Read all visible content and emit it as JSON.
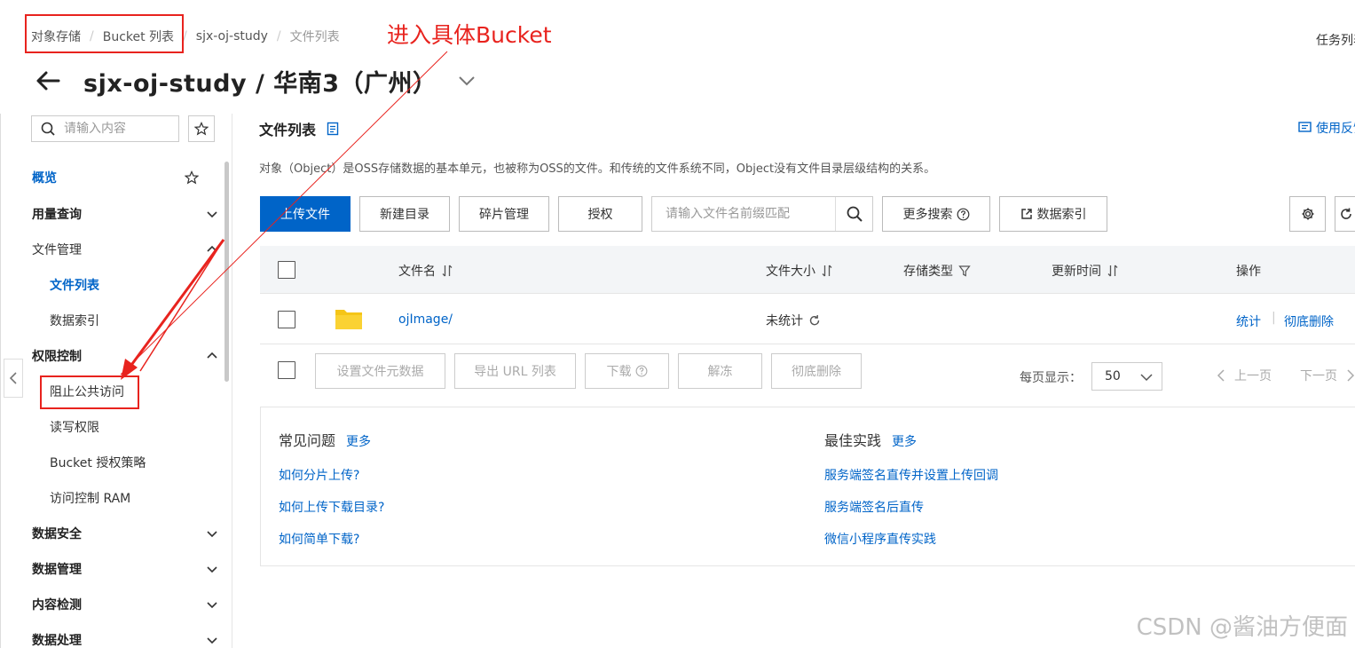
{
  "breadcrumb": [
    "对象存储",
    "Bucket 列表",
    "sjx-oj-study",
    "文件列表"
  ],
  "header": {
    "task_list": "任务列表",
    "title": "sjx-oj-study / 华南3（广州）"
  },
  "sidebar": {
    "search_placeholder": "请输入内容",
    "items": [
      {
        "label": "概览"
      },
      {
        "label": "用量查询"
      },
      {
        "label": "文件管理"
      },
      {
        "label": "文件列表"
      },
      {
        "label": "数据索引"
      },
      {
        "label": "权限控制"
      },
      {
        "label": "阻止公共访问"
      },
      {
        "label": "读写权限"
      },
      {
        "label": "Bucket 授权策略"
      },
      {
        "label": "访问控制 RAM"
      },
      {
        "label": "数据安全"
      },
      {
        "label": "数据管理"
      },
      {
        "label": "内容检测"
      },
      {
        "label": "数据处理"
      }
    ]
  },
  "main": {
    "section_title": "文件列表",
    "feedback": "使用反馈",
    "description": "对象（Object）是OSS存储数据的基本单元，也被称为OSS的文件。和传统的文件系统不同，Object没有文件目录层级结构的关系。",
    "toolbar": {
      "upload": "上传文件",
      "new_dir": "新建目录",
      "fragments": "碎片管理",
      "authorize": "授权",
      "search_placeholder": "请输入文件名前缀匹配",
      "more_search": "更多搜索",
      "data_index": "数据索引"
    },
    "table": {
      "columns": [
        "文件名",
        "文件大小",
        "存储类型",
        "更新时间",
        "操作"
      ],
      "rows": [
        {
          "name": "ojImage/",
          "size": "未统计",
          "actions": [
            "统计",
            "彻底删除"
          ]
        }
      ]
    },
    "batch_actions": [
      "设置文件元数据",
      "导出 URL 列表",
      "下载",
      "解冻",
      "彻底删除"
    ],
    "pagination": {
      "page_size_label": "每页显示：",
      "page_size": "50",
      "prev": "上一页",
      "next": "下一页"
    }
  },
  "help": {
    "faq_title": "常见问题",
    "faq_more": "更多",
    "faq_links": [
      "如何分片上传?",
      "如何上传下载目录?",
      "如何简单下载?"
    ],
    "best_title": "最佳实践",
    "best_more": "更多",
    "best_links": [
      "服务端签名直传并设置上传回调",
      "服务端签名后直传",
      "微信小程序直传实践"
    ]
  },
  "annotation": "进入具体Bucket",
  "watermark": "CSDN @酱油方便面",
  "colors": {
    "accent": "#0064c8",
    "annotation_red": "#e8231e",
    "folder": "#f5c518"
  }
}
